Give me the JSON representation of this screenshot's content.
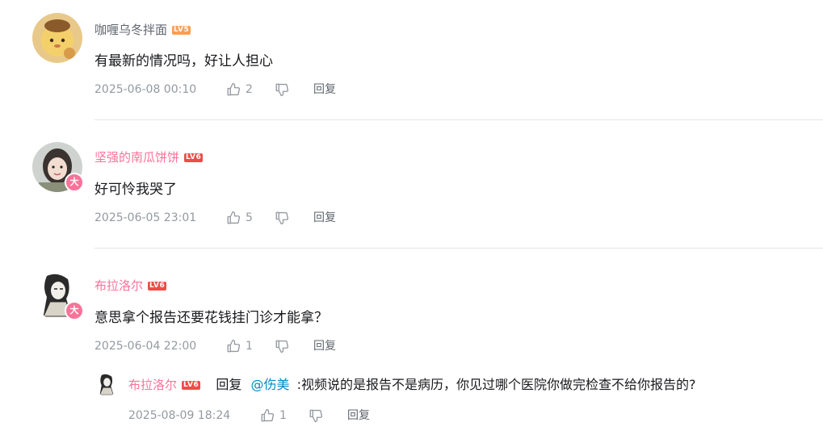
{
  "comments": [
    {
      "username": "咖喱乌冬拌面",
      "level": "LV5",
      "content": "有最新的情况吗，好让人担心",
      "time": "2025-06-08 00:10",
      "likes": "2",
      "reply_label": "回复"
    },
    {
      "username": "坚强的南瓜饼饼",
      "level": "LV6",
      "badge": "大",
      "content": "好可怜我哭了",
      "time": "2025-06-05 23:01",
      "likes": "5",
      "reply_label": "回复"
    },
    {
      "username": "布拉洛尔",
      "level": "LV6",
      "badge": "大",
      "content": "意思拿个报告还要花钱挂门诊才能拿？",
      "time": "2025-06-04 22:00",
      "likes": "1",
      "reply_label": "回复"
    }
  ],
  "sub_reply": {
    "username": "布拉洛尔",
    "level": "LV6",
    "reply_word": "回复",
    "mention": "@伤美",
    "text": ":视频说的是报告不是病历，你见过哪个医院你做完检查不给你报告的?",
    "time": "2025-08-09 18:24",
    "likes": "1",
    "reply_label": "回复"
  },
  "colors": {
    "vip_pink": "#fb7299",
    "lv5": "#ff9e4f",
    "lv6": "#f04c49",
    "mention": "#008ac5",
    "meta_gray": "#9499a0"
  },
  "icons": [
    "like-icon",
    "dislike-icon"
  ]
}
